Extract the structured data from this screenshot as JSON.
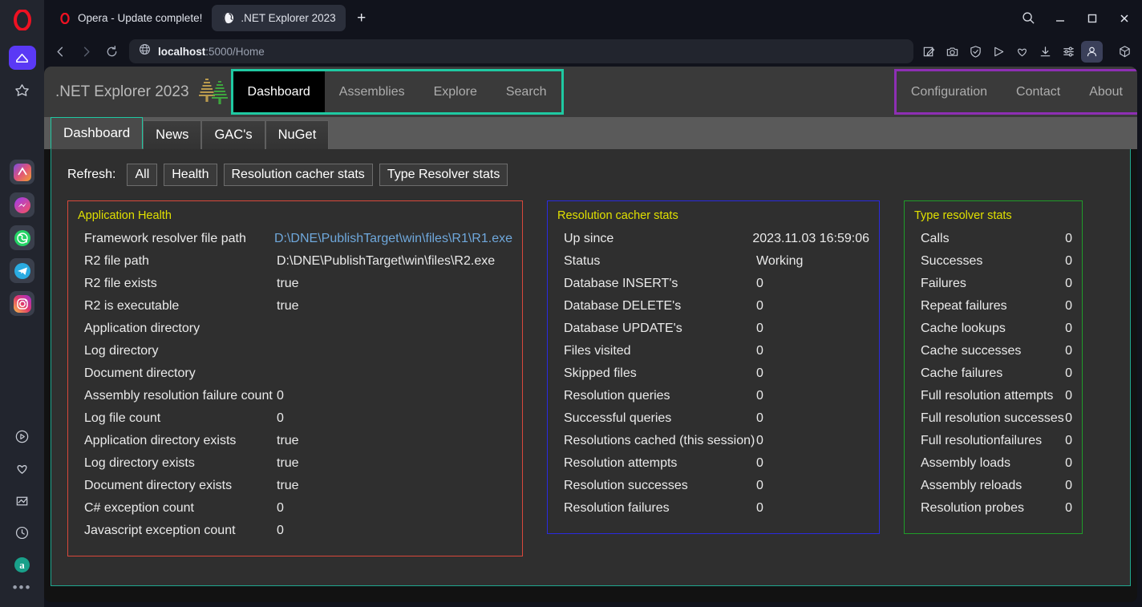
{
  "browser": {
    "name": "Opera",
    "tabs": [
      {
        "title": "Opera - Update complete!",
        "icon": "opera-logo-icon",
        "selected": false
      },
      {
        "title": ".NET Explorer 2023",
        "icon": "globe-favicon-icon",
        "selected": true
      }
    ],
    "new_tab_label": "+",
    "window_controls": [
      "search-icon",
      "minimize-icon",
      "maximize-icon",
      "close-icon"
    ],
    "nav": {
      "back": "back-icon",
      "forward": "forward-icon",
      "reload": "reload-icon",
      "site_icon": "globe-icon",
      "url_host": "localhost",
      "url_path": ":5000/Home"
    },
    "toolbar_icons": [
      "snapshot-edit-icon",
      "camera-icon",
      "shield-icon",
      "send-icon",
      "heart-icon",
      "download-icon",
      "easy-setup-icon",
      "profile-icon",
      "package-icon"
    ],
    "sidebar_icons": [
      "opera-logo-icon",
      "home-icon",
      "favorites-star-icon",
      "ai-assistant-icon",
      "messenger-icon",
      "whatsapp-icon",
      "telegram-icon",
      "instagram-icon",
      "player-icon",
      "heart-icon",
      "pinboard-icon",
      "history-icon",
      "amazon-icon",
      "more-dots-icon"
    ]
  },
  "site": {
    "brand": {
      "title": ".NET Explorer 2023",
      "logo": "pine-trees-icon"
    },
    "nav_left": [
      {
        "label": "Dashboard",
        "active": true
      },
      {
        "label": "Assemblies",
        "active": false
      },
      {
        "label": "Explore",
        "active": false
      },
      {
        "label": "Search",
        "active": false
      }
    ],
    "nav_right": [
      {
        "label": "Configuration"
      },
      {
        "label": "Contact"
      },
      {
        "label": "About"
      }
    ],
    "highlight_colors": {
      "nav_left_box": "#1fc9a2",
      "nav_right_box": "#8e2fb4"
    },
    "tabs": [
      {
        "label": "Dashboard",
        "selected": true
      },
      {
        "label": "News",
        "selected": false
      },
      {
        "label": "GAC's",
        "selected": false
      },
      {
        "label": "NuGet",
        "selected": false
      }
    ],
    "refresh": {
      "label": "Refresh:",
      "buttons": [
        "All",
        "Health",
        "Resolution cacher stats",
        "Type Resolver stats"
      ]
    },
    "panels": [
      {
        "title": "Application Health",
        "border_color": "#d9483b",
        "rows": [
          {
            "label": "Framework resolver file path",
            "value": "D:\\DNE\\PublishTarget\\win\\files\\R1\\R1.exe",
            "is_link": true
          },
          {
            "label": "R2 file path",
            "value": "D:\\DNE\\PublishTarget\\win\\files\\R2.exe",
            "is_link": false
          },
          {
            "label": "R2 file exists",
            "value": "true",
            "is_link": false
          },
          {
            "label": "R2 is executable",
            "value": "true",
            "is_link": false
          },
          {
            "label": "Application directory",
            "value": "",
            "is_link": false
          },
          {
            "label": "Log directory",
            "value": "",
            "is_link": false
          },
          {
            "label": "Document directory",
            "value": "",
            "is_link": false
          },
          {
            "label": "Assembly resolution failure count",
            "value": "0",
            "is_link": false
          },
          {
            "label": "Log file count",
            "value": "0",
            "is_link": false
          },
          {
            "label": "Application directory exists",
            "value": "true",
            "is_link": false
          },
          {
            "label": "Log directory exists",
            "value": "true",
            "is_link": false
          },
          {
            "label": "Document directory exists",
            "value": "true",
            "is_link": false
          },
          {
            "label": "C# exception count",
            "value": "0",
            "is_link": false
          },
          {
            "label": "Javascript exception count",
            "value": "0",
            "is_link": false
          }
        ]
      },
      {
        "title": "Resolution cacher stats",
        "border_color": "#2a2ae0",
        "rows": [
          {
            "label": "Up since",
            "value": "2023.11.03 16:59:06",
            "is_link": false
          },
          {
            "label": "Status",
            "value": "Working",
            "is_link": false
          },
          {
            "label": "Database INSERT's",
            "value": "0",
            "is_link": false
          },
          {
            "label": "Database DELETE's",
            "value": "0",
            "is_link": false
          },
          {
            "label": "Database UPDATE's",
            "value": "0",
            "is_link": false
          },
          {
            "label": "Files visited",
            "value": "0",
            "is_link": false
          },
          {
            "label": "Skipped files",
            "value": "0",
            "is_link": false
          },
          {
            "label": "Resolution queries",
            "value": "0",
            "is_link": false
          },
          {
            "label": "Successful queries",
            "value": "0",
            "is_link": false
          },
          {
            "label": "Resolutions cached (this session)",
            "value": "0",
            "is_link": false
          },
          {
            "label": "Resolution attempts",
            "value": "0",
            "is_link": false
          },
          {
            "label": "Resolution successes",
            "value": "0",
            "is_link": false
          },
          {
            "label": "Resolution failures",
            "value": "0",
            "is_link": false
          }
        ]
      },
      {
        "title": "Type resolver stats",
        "border_color": "#1f9c29",
        "rows": [
          {
            "label": "Calls",
            "value": "0",
            "is_link": false
          },
          {
            "label": "Successes",
            "value": "0",
            "is_link": false
          },
          {
            "label": "Failures",
            "value": "0",
            "is_link": false
          },
          {
            "label": "Repeat failures",
            "value": "0",
            "is_link": false
          },
          {
            "label": "Cache lookups",
            "value": "0",
            "is_link": false
          },
          {
            "label": "Cache successes",
            "value": "0",
            "is_link": false
          },
          {
            "label": "Cache failures",
            "value": "0",
            "is_link": false
          },
          {
            "label": "Full resolution attempts",
            "value": "0",
            "is_link": false
          },
          {
            "label": "Full resolution successes",
            "value": "0",
            "is_link": false
          },
          {
            "label": "Full resolutionfailures",
            "value": "0",
            "is_link": false
          },
          {
            "label": "Assembly loads",
            "value": "0",
            "is_link": false
          },
          {
            "label": "Assembly reloads",
            "value": "0",
            "is_link": false
          },
          {
            "label": "Resolution probes",
            "value": "0",
            "is_link": false
          }
        ]
      }
    ]
  }
}
